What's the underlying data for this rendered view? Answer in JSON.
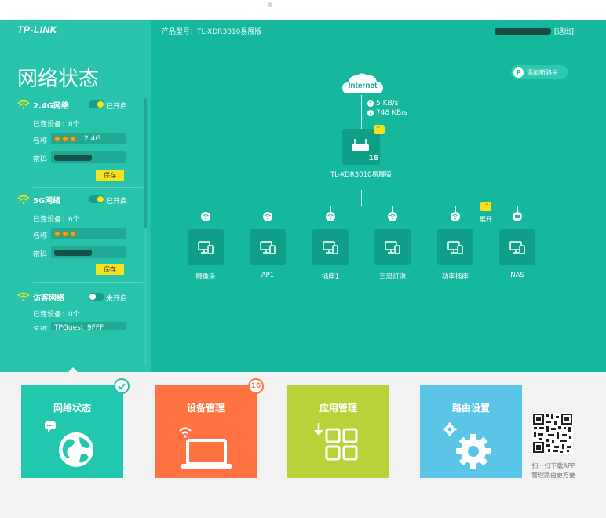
{
  "header": {
    "logo": "TP-LINK",
    "model_text": "产品型号：TL-XDR3010易展版",
    "logout": "[退出]"
  },
  "left_panel": {
    "title": "网络状态",
    "networks": [
      {
        "name": "2.4G网络",
        "status": "已开启",
        "connected": "已连设备：8个",
        "name_label": "名称",
        "name_value": "2.4G",
        "pwd_label": "密码",
        "save": "保存"
      },
      {
        "name": "5G网络",
        "status": "已开启",
        "connected": "已连设备：6个",
        "name_label": "名称",
        "pwd_label": "密码",
        "save": "保存"
      },
      {
        "name": "访客网络",
        "status": "未开启",
        "connected": "已连设备：0个",
        "name_label": "名称",
        "name_value": "TPGuest_9FFF"
      }
    ]
  },
  "topology": {
    "add_router": "添加新路由",
    "internet": "Internet",
    "upload_speed": "5 KB/s",
    "download_speed": "748 KB/s",
    "router_label": "TL-XDR3010易展版",
    "router_badge": "16",
    "expand_label": "展开",
    "devices": [
      {
        "label": "摄像头",
        "link": "wifi"
      },
      {
        "label": "AP1",
        "link": "wifi"
      },
      {
        "label": "插座1",
        "link": "wifi"
      },
      {
        "label": "三思灯泡",
        "link": "wifi"
      },
      {
        "label": "功率插座",
        "link": "wifi"
      },
      {
        "label": "NAS",
        "link": "wired"
      }
    ]
  },
  "nav_tiles": [
    {
      "label": "网络状态",
      "color": "#21c8ae",
      "icon": "globe-icon",
      "active": true
    },
    {
      "label": "设备管理",
      "color": "#ff7343",
      "icon": "laptop-icon",
      "badge": "16"
    },
    {
      "label": "应用管理",
      "color": "#b8d23a",
      "icon": "apps-grid-icon"
    },
    {
      "label": "路由设置",
      "color": "#5ac5e6",
      "icon": "gear-icon"
    }
  ],
  "qr": {
    "caption_line1": "扫一扫下载APP",
    "caption_line2": "管理路由更方便"
  },
  "colors": {
    "main_bg": "#15b79d",
    "left_bg": "#27c4ab",
    "device_box": "#0f9e87",
    "accent_yellow": "#f7e31d"
  }
}
